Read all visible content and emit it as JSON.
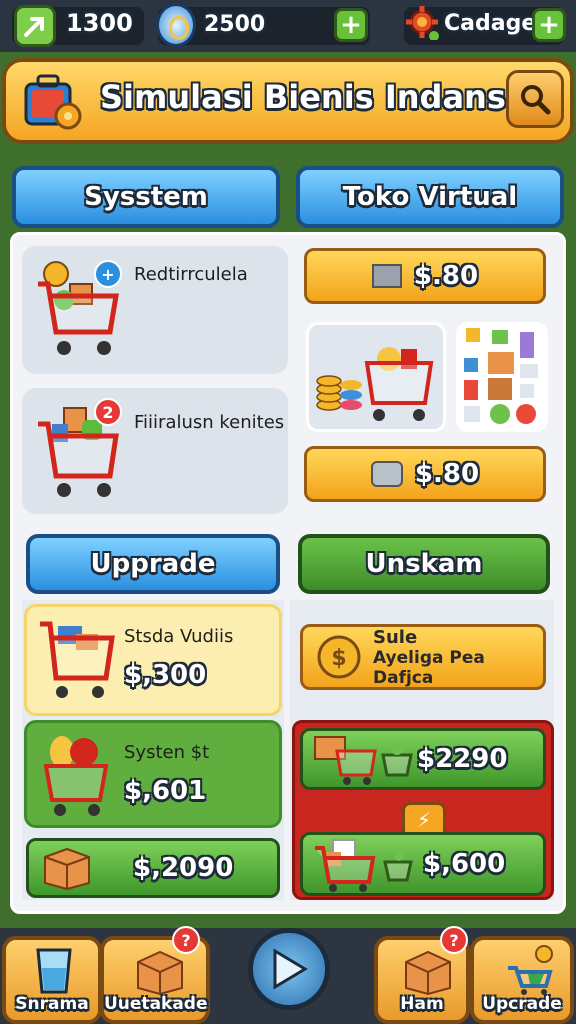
{
  "topbar": {
    "resource1_value": "1300",
    "resource2_value": "2500",
    "resource3_label": "Cadagee"
  },
  "header": {
    "title": "Simulasi Bienis Indansia"
  },
  "tabs": {
    "system": "Sysstem",
    "virtual_store": "Toko Virtual",
    "upgrade": "Upprade",
    "unskam": "Unskam"
  },
  "left_items": [
    {
      "label": "Redtirrculela",
      "badge": "+"
    },
    {
      "label": "Fiiiralusn kenites",
      "badge": "2"
    }
  ],
  "store_buttons": [
    {
      "price": "$.80"
    },
    {
      "price": "$.80"
    }
  ],
  "upgrade_cards": [
    {
      "label": "Stsda Vudiis",
      "price": "$,300"
    },
    {
      "label": "Systen $t",
      "price": "$,601"
    },
    {
      "label": "",
      "price": "$,2090"
    }
  ],
  "unskam_cards": {
    "promo_title": "Sule",
    "promo_subtitle": "Ayeliga Pea Dafjca",
    "offer1_price": "$2290",
    "offer2_price": "$,600"
  },
  "bottom_nav": [
    {
      "label": "Snrama",
      "icon": "cup-icon"
    },
    {
      "label": "Uuetakade",
      "icon": "box-icon",
      "badge": "?"
    },
    {
      "label": "",
      "icon": "play-icon"
    },
    {
      "label": "Ham",
      "icon": "box-icon",
      "badge": "?"
    },
    {
      "label": "Upcrade",
      "icon": "cart-icon"
    }
  ],
  "colors": {
    "accent_orange": "#f4a623",
    "accent_blue": "#2b8fe0",
    "accent_green": "#3d8d2a",
    "alert_red": "#c8261f"
  }
}
